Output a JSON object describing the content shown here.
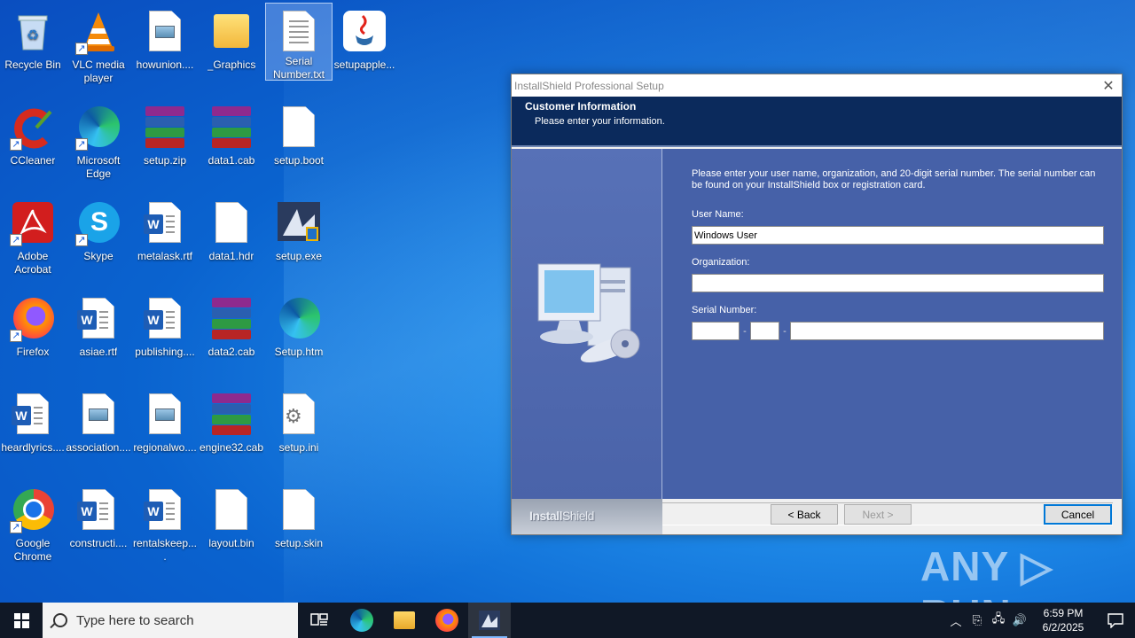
{
  "desktop": {
    "icons": [
      {
        "label": "Recycle Bin",
        "icon": "recycle-bin-icon"
      },
      {
        "label": "VLC media player",
        "icon": "vlc-icon"
      },
      {
        "label": "howunion....",
        "icon": "image-file-icon"
      },
      {
        "label": "_Graphics",
        "icon": "folder-icon"
      },
      {
        "label": "Serial Number.txt",
        "icon": "text-file-icon"
      },
      {
        "label": "setupapple...",
        "icon": "java-icon"
      },
      {
        "label": "CCleaner",
        "icon": "ccleaner-icon"
      },
      {
        "label": "Microsoft Edge",
        "icon": "edge-icon"
      },
      {
        "label": "setup.zip",
        "icon": "winrar-icon"
      },
      {
        "label": "data1.cab",
        "icon": "winrar-icon"
      },
      {
        "label": "setup.boot",
        "icon": "blank-file-icon"
      },
      {
        "label": "Adobe Acrobat",
        "icon": "acrobat-icon"
      },
      {
        "label": "Skype",
        "icon": "skype-icon"
      },
      {
        "label": "metalask.rtf",
        "icon": "word-doc-icon"
      },
      {
        "label": "data1.hdr",
        "icon": "blank-file-icon"
      },
      {
        "label": "setup.exe",
        "icon": "installer-icon"
      },
      {
        "label": "Firefox",
        "icon": "firefox-icon"
      },
      {
        "label": "asiae.rtf",
        "icon": "word-doc-icon"
      },
      {
        "label": "publishing....",
        "icon": "word-doc-icon"
      },
      {
        "label": "data2.cab",
        "icon": "winrar-icon"
      },
      {
        "label": "Setup.htm",
        "icon": "edge-icon"
      },
      {
        "label": "heardlyrics....",
        "icon": "word-doc-icon"
      },
      {
        "label": "association....",
        "icon": "image-file-icon"
      },
      {
        "label": "regionalwo....",
        "icon": "image-file-icon"
      },
      {
        "label": "engine32.cab",
        "icon": "winrar-icon"
      },
      {
        "label": "setup.ini",
        "icon": "settings-file-icon"
      },
      {
        "label": "Google Chrome",
        "icon": "chrome-icon"
      },
      {
        "label": "constructi....",
        "icon": "word-doc-icon"
      },
      {
        "label": "rentalskeep....",
        "icon": "word-doc-icon"
      },
      {
        "label": "layout.bin",
        "icon": "blank-file-icon"
      },
      {
        "label": "setup.skin",
        "icon": "blank-file-icon"
      }
    ]
  },
  "dialog": {
    "title": "InstallShield Professional Setup",
    "header_title": "Customer Information",
    "header_subtitle": "Please enter your information.",
    "intro": "Please enter your user name, organization, and 20-digit serial number. The serial number can be found on your InstallShield box or registration card.",
    "user_name_label": "User Name:",
    "user_name_value": "Windows User",
    "organization_label": "Organization:",
    "organization_value": "",
    "serial_label": "Serial Number:",
    "serial_sep": "-",
    "brand_bold": "Install",
    "brand_thin": "Shield",
    "back_label": "< Back",
    "next_label": "Next >",
    "cancel_label": "Cancel"
  },
  "taskbar": {
    "search_placeholder": "Type here to search",
    "time": "6:59 PM",
    "date": "6/2/2025"
  },
  "watermark": "ANY ▷ RUN"
}
